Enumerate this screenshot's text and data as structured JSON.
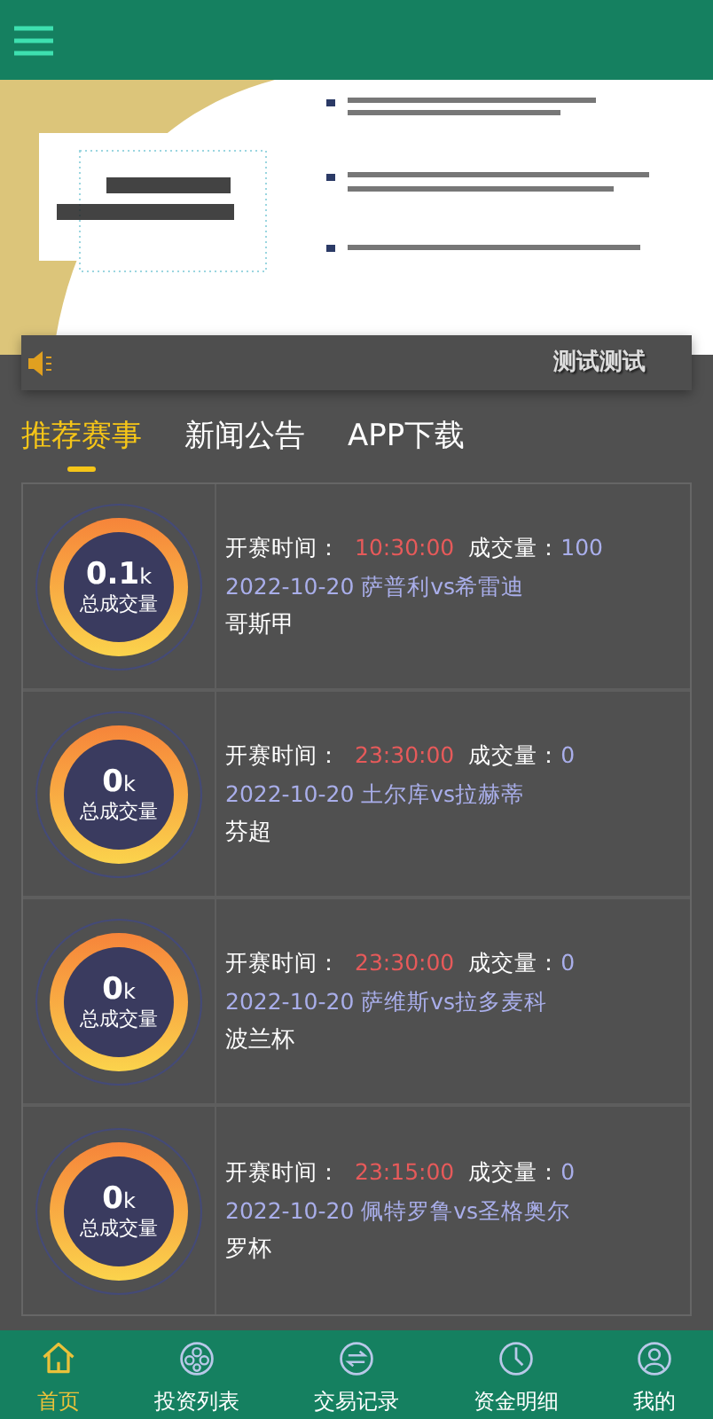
{
  "notice": {
    "text": "测试测试"
  },
  "tabs": [
    {
      "label": "推荐赛事",
      "selected": true
    },
    {
      "label": "新闻公告",
      "selected": false
    },
    {
      "label": "APP下载",
      "selected": false
    }
  ],
  "matches": [
    {
      "total_value": "0.1",
      "total_unit": "k",
      "total_label": "总成交量",
      "time_label": "开赛时间：",
      "time": "10:30:00",
      "volume_label": "成交量：",
      "volume": "100",
      "fixture": "2022-10-20 萨普利vs希雷迪",
      "league": "哥斯甲"
    },
    {
      "total_value": "0",
      "total_unit": "k",
      "total_label": "总成交量",
      "time_label": "开赛时间：",
      "time": "23:30:00",
      "volume_label": "成交量：",
      "volume": "0",
      "fixture": "2022-10-20 土尔库vs拉赫蒂",
      "league": "芬超"
    },
    {
      "total_value": "0",
      "total_unit": "k",
      "total_label": "总成交量",
      "time_label": "开赛时间：",
      "time": "23:30:00",
      "volume_label": "成交量：",
      "volume": "0",
      "fixture": "2022-10-20 萨维斯vs拉多麦科",
      "league": "波兰杯"
    },
    {
      "total_value": "0",
      "total_unit": "k",
      "total_label": "总成交量",
      "time_label": "开赛时间：",
      "time": "23:15:00",
      "volume_label": "成交量：",
      "volume": "0",
      "fixture": "2022-10-20 佩特罗鲁vs圣格奥尔",
      "league": "罗杯"
    }
  ],
  "bottom_nav": [
    {
      "label": "首页",
      "selected": true
    },
    {
      "label": "投资列表",
      "selected": false
    },
    {
      "label": "交易记录",
      "selected": false
    },
    {
      "label": "资金明细",
      "selected": false
    },
    {
      "label": "我的",
      "selected": false
    }
  ]
}
